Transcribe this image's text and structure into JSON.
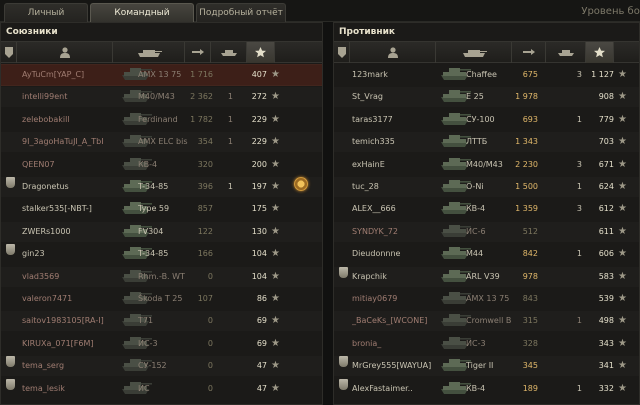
{
  "tabs": [
    {
      "label": "Личный результат",
      "active": false
    },
    {
      "label": "Командный результат",
      "active": true
    },
    {
      "label": "Подробный отчёт",
      "active": false
    }
  ],
  "level_label": "Уровень бое",
  "allies": {
    "title": "Союзники",
    "rows": [
      {
        "player": "AyTuCm[YAP_C]",
        "tank": "AMX 13 75",
        "damage": "1 716",
        "kills": "",
        "xp": "407",
        "badge": false,
        "medal": false,
        "dead": true,
        "highlight": true
      },
      {
        "player": "intelli99ent",
        "tank": "M40/M43",
        "damage": "2 362",
        "kills": "1",
        "xp": "272",
        "badge": false,
        "medal": false,
        "dead": true,
        "highlight": false
      },
      {
        "player": "zelebobakill",
        "tank": "Ferdinand",
        "damage": "1 782",
        "kills": "1",
        "xp": "229",
        "badge": false,
        "medal": false,
        "dead": true,
        "highlight": false
      },
      {
        "player": "9I_3agoHaTuJI_A_TbI",
        "tank": "AMX ELC bis",
        "damage": "354",
        "kills": "1",
        "xp": "229",
        "badge": false,
        "medal": false,
        "dead": true,
        "highlight": false
      },
      {
        "player": "QEEN07",
        "tank": "КВ-4",
        "damage": "320",
        "kills": "",
        "xp": "200",
        "badge": false,
        "medal": false,
        "dead": true,
        "highlight": false
      },
      {
        "player": "Dragonetus",
        "tank": "T-34-85",
        "damage": "396",
        "kills": "1",
        "xp": "197",
        "badge": true,
        "medal": true,
        "dead": false,
        "highlight": false
      },
      {
        "player": "stalker535[-NBT-]",
        "tank": "Type 59",
        "damage": "857",
        "kills": "",
        "xp": "175",
        "badge": false,
        "medal": false,
        "dead": false,
        "highlight": false
      },
      {
        "player": "ZWERs1000",
        "tank": "FV304",
        "damage": "122",
        "kills": "",
        "xp": "130",
        "badge": false,
        "medal": false,
        "dead": false,
        "highlight": false
      },
      {
        "player": "gin23",
        "tank": "T-34-85",
        "damage": "166",
        "kills": "",
        "xp": "104",
        "badge": true,
        "medal": false,
        "dead": false,
        "highlight": false
      },
      {
        "player": "vlad3569",
        "tank": "Rhm.-B. WT",
        "damage": "0",
        "kills": "",
        "xp": "104",
        "badge": false,
        "medal": false,
        "dead": true,
        "highlight": false
      },
      {
        "player": "valeron7471",
        "tank": "Škoda T 25",
        "damage": "107",
        "kills": "",
        "xp": "86",
        "badge": false,
        "medal": false,
        "dead": true,
        "highlight": false
      },
      {
        "player": "saitov1983105[RA-I]",
        "tank": "T71",
        "damage": "0",
        "kills": "",
        "xp": "69",
        "badge": false,
        "medal": false,
        "dead": true,
        "highlight": false
      },
      {
        "player": "KIRUXa_071[F6M]",
        "tank": "ИС-3",
        "damage": "0",
        "kills": "",
        "xp": "69",
        "badge": false,
        "medal": false,
        "dead": true,
        "highlight": false
      },
      {
        "player": "tema_serg",
        "tank": "СУ-152",
        "damage": "0",
        "kills": "",
        "xp": "47",
        "badge": true,
        "medal": false,
        "dead": true,
        "highlight": false
      },
      {
        "player": "tema_lesik",
        "tank": "ИС",
        "damage": "0",
        "kills": "",
        "xp": "47",
        "badge": true,
        "medal": false,
        "dead": true,
        "highlight": false
      }
    ]
  },
  "enemies": {
    "title": "Противник",
    "rows": [
      {
        "player": "123mark",
        "tank": "Chaffee",
        "damage": "675",
        "kills": "3",
        "xp": "1 127",
        "badge": false,
        "dead": false
      },
      {
        "player": "St_Vrag",
        "tank": "E 25",
        "damage": "1 978",
        "kills": "",
        "xp": "908",
        "badge": false,
        "dead": false
      },
      {
        "player": "taras3177",
        "tank": "СУ-100",
        "damage": "693",
        "kills": "1",
        "xp": "779",
        "badge": false,
        "dead": false
      },
      {
        "player": "temich335",
        "tank": "ЛТТБ",
        "damage": "1 343",
        "kills": "",
        "xp": "703",
        "badge": false,
        "dead": false
      },
      {
        "player": "exHainE",
        "tank": "M40/M43",
        "damage": "2 230",
        "kills": "3",
        "xp": "671",
        "badge": false,
        "dead": false
      },
      {
        "player": "tuc_28",
        "tank": "O-Ni",
        "damage": "1 500",
        "kills": "1",
        "xp": "624",
        "badge": false,
        "dead": false
      },
      {
        "player": "ALEX__666",
        "tank": "КВ-4",
        "damage": "1 359",
        "kills": "3",
        "xp": "612",
        "badge": false,
        "dead": false
      },
      {
        "player": "SYNDYK_72",
        "tank": "ИС-6",
        "damage": "512",
        "kills": "",
        "xp": "611",
        "badge": false,
        "dead": true
      },
      {
        "player": "Dieudonnne",
        "tank": "M44",
        "damage": "842",
        "kills": "1",
        "xp": "606",
        "badge": false,
        "dead": false
      },
      {
        "player": "Krapchik",
        "tank": "ARL V39",
        "damage": "978",
        "kills": "",
        "xp": "583",
        "badge": true,
        "dead": false
      },
      {
        "player": "mitiay0679",
        "tank": "AMX 13 75",
        "damage": "843",
        "kills": "",
        "xp": "539",
        "badge": false,
        "dead": true
      },
      {
        "player": "_BaCeKs_[WCONE]",
        "tank": "Cromwell B",
        "damage": "315",
        "kills": "1",
        "xp": "498",
        "badge": false,
        "dead": true
      },
      {
        "player": "bronia_",
        "tank": "ИС-3",
        "damage": "328",
        "kills": "",
        "xp": "343",
        "badge": false,
        "dead": true
      },
      {
        "player": "MrGrey555[WAYUA]",
        "tank": "Tiger II",
        "damage": "345",
        "kills": "",
        "xp": "341",
        "badge": true,
        "dead": false
      },
      {
        "player": "AlexFastaimer..",
        "tank": "КВ-4",
        "damage": "189",
        "kills": "1",
        "xp": "332",
        "badge": true,
        "dead": false
      }
    ]
  },
  "colors": {
    "accent_gold": "#e1b86a",
    "dead_name": "#a07d72",
    "highlight_row": "#5a2414"
  },
  "icons": [
    "platoon-badge-icon",
    "player-icon",
    "tank-icon",
    "damage-icon",
    "kills-icon",
    "star-icon",
    "medal-icon"
  ]
}
